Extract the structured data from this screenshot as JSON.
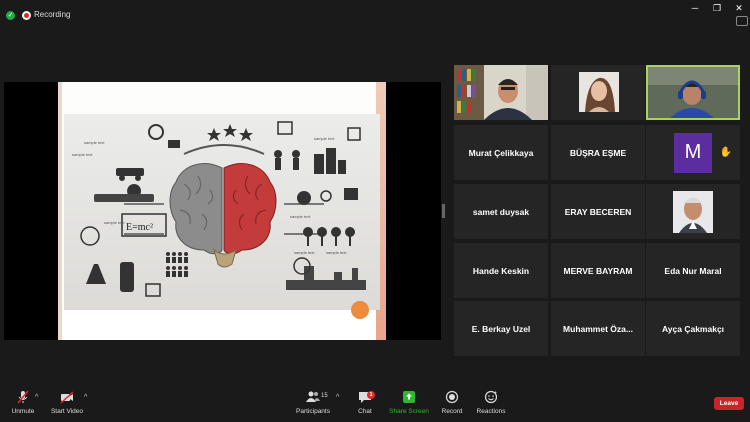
{
  "topbar": {
    "recording_label": "Recording"
  },
  "participants": {
    "names": [
      "Murat Çelikkaya",
      "BÜŞRA EŞME",
      "samet duysak",
      "ERAY BECEREN",
      "Hande Keskin",
      "MERVE BAYRAM",
      "Eda Nur Maral",
      "E. Berkay Uzel",
      "Muhammet  Öza...",
      "Ayça Çakmakçı"
    ],
    "avatar_letter": "M",
    "avatar_color": "#5b2d9e",
    "active_speaker_color": "#a8d45e"
  },
  "slide": {
    "formula": "E=mc²",
    "sample_texts": [
      "sample text",
      "sample text",
      "sample text",
      "sample text",
      "sample text",
      "sample text",
      "sample text"
    ]
  },
  "toolbar": {
    "unmute": "Unmute",
    "start_video": "Start Video",
    "participants": "Participants",
    "participants_count": "15",
    "chat": "Chat",
    "chat_badge": "1",
    "share_screen": "Share Screen",
    "record": "Record",
    "reactions": "Reactions",
    "leave": "Leave",
    "share_color": "#2eb82e",
    "leave_color": "#c8252b"
  }
}
